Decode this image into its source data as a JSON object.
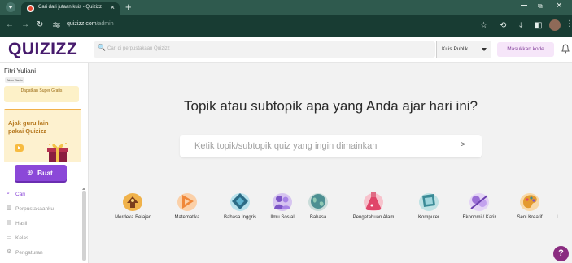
{
  "browser": {
    "tab_title": "Cari dari jutaan kuis - Quizizz",
    "tab_close": "×",
    "new_tab": "+",
    "url_host": "quizizz.com",
    "url_path": "/admin",
    "icons": [
      "tab-search-icon",
      "back-arrow-icon",
      "forward-arrow-icon",
      "reload-icon",
      "site-settings-icon",
      "star-icon",
      "extensions-icon",
      "download-icon",
      "sidebar-icon",
      "profile-avatar",
      "more-menu-icon",
      "minimize-icon",
      "maximize-icon",
      "close-icon"
    ]
  },
  "header": {
    "logo": "QUIZIZZ",
    "search_placeholder": "Cari di perpustakaan Quizizz",
    "filter_label": "Kuis Publik",
    "join_code_button": "Masukkan kode"
  },
  "sidebar": {
    "user_name": "Fitri Yuliani",
    "plan_badge": "Akun Basic",
    "upgrade_label": "Dapatkan Super Gratis",
    "promo_text": "Ajak guru lain pakai Quizizz",
    "create_button": "Buat",
    "nav": [
      {
        "label": "Cari",
        "icon": "search-icon",
        "active": true
      },
      {
        "label": "Perpustakaanku",
        "icon": "library-icon",
        "active": false
      },
      {
        "label": "Hasil",
        "icon": "results-icon",
        "active": false
      },
      {
        "label": "Kelas",
        "icon": "class-icon",
        "active": false
      },
      {
        "label": "Pengaturan",
        "icon": "settings-icon",
        "active": false
      }
    ]
  },
  "main": {
    "heading": "Topik atau subtopik apa yang Anda ajar hari ini?",
    "topic_placeholder": "Ketik topik/subtopik quiz yang ingin dimainkan",
    "categories": [
      {
        "label": "Merdeka Belajar"
      },
      {
        "label": "Matematika"
      },
      {
        "label": "Bahasa Inggris"
      },
      {
        "label": "Ilmu Sosial"
      },
      {
        "label": "Bahasa"
      },
      {
        "label": "Pengetahuan Alam"
      },
      {
        "label": "Komputer"
      },
      {
        "label": "Ekonomi / Karir"
      },
      {
        "label": "Seni Kreatif"
      }
    ],
    "help_label": "?"
  },
  "colors": {
    "brand_purple": "#461a6c",
    "create_button": "#8b48d8",
    "promo_bg": "#fdf1cf",
    "browser_frame": "#183c33"
  }
}
